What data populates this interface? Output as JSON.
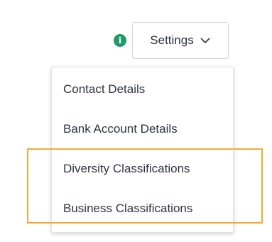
{
  "info": {
    "icon": "info-icon",
    "glyph": "i",
    "color": "#1f9a6a"
  },
  "settings": {
    "label": "Settings",
    "chevron_icon": "chevron-down-icon"
  },
  "menu": {
    "items": [
      {
        "label": "Contact Details"
      },
      {
        "label": "Bank Account Details"
      },
      {
        "label": "Diversity Classifications"
      },
      {
        "label": "Business Classifications"
      }
    ]
  },
  "highlight": {
    "color": "#f4a83a"
  }
}
